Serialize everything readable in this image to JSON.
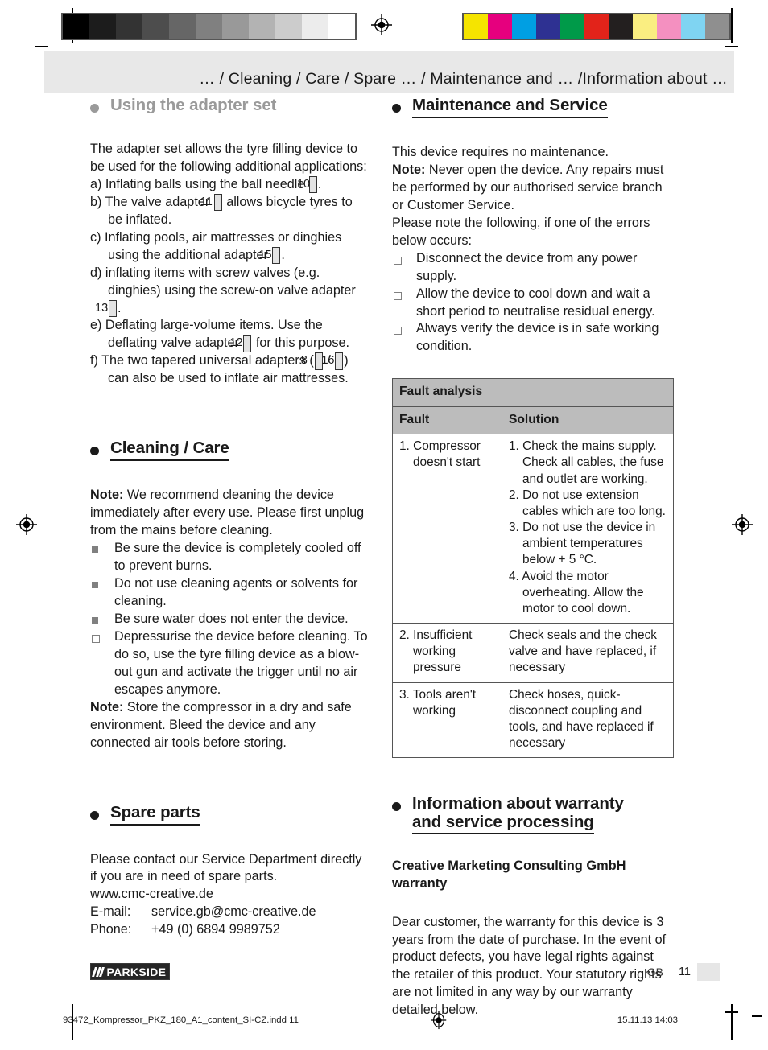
{
  "print_marks": {
    "grayscale_swatches": [
      "#000000",
      "#1c1c1c",
      "#333333",
      "#4d4d4d",
      "#666666",
      "#808080",
      "#999999",
      "#b3b3b3",
      "#cccccc",
      "#ececec",
      "#ffffff"
    ],
    "color_swatches": [
      "#f5e400",
      "#e6007e",
      "#009fe3",
      "#2e3192",
      "#009a49",
      "#e2231a",
      "#231f1f",
      "#faee81",
      "#f490c0",
      "#7fd4f2",
      "#8f8f8f"
    ],
    "registration_icon": "registration-target-icon"
  },
  "header": {
    "breadcrumb": "… / Cleaning / Care / Spare … / Maintenance and … /Information about …"
  },
  "left_column": {
    "adapter_section": {
      "heading": "Using the adapter set",
      "muted": true,
      "intro": "The adapter set allows the tyre filling device to be used for the following additional applications:",
      "items": [
        {
          "marker": "a)",
          "text_before": "Inflating balls using the ball needle ",
          "refs": [
            "10"
          ],
          "text_after": "."
        },
        {
          "marker": "b)",
          "text_before": "The valve adapter ",
          "refs": [
            "11"
          ],
          "text_after": " allows bicycle tyres to be inflated."
        },
        {
          "marker": "c)",
          "text_before": "Inflating pools, air mattresses or dinghies using the additional adapter ",
          "refs": [
            "15"
          ],
          "text_after": "."
        },
        {
          "marker": "d)",
          "text_before": "inflating items with screw valves (e.g. dinghies) using the screw-on valve adapter ",
          "refs": [
            "13"
          ],
          "text_after": "."
        },
        {
          "marker": "e)",
          "text_before": "Deflating large-volume items. Use the deflating valve adapter ",
          "refs": [
            "12"
          ],
          "text_after": " for this purpose."
        },
        {
          "marker": "f)",
          "text_before": "The two tapered universal adapters (",
          "refs": [
            "8",
            "16"
          ],
          "separator": " / ",
          "text_after": ") can also be used to inflate air mattresses."
        }
      ]
    },
    "cleaning_section": {
      "heading": "Cleaning / Care",
      "note_label": "Note:",
      "note_text": " We recommend cleaning the device immediately after every use. Please first unplug from the mains before cleaning.",
      "bullets": [
        {
          "marker": "filled",
          "text": "Be sure the device is completely cooled off to prevent burns."
        },
        {
          "marker": "filled",
          "text": "Do not use cleaning agents or solvents for cleaning."
        },
        {
          "marker": "filled",
          "text": "Be sure water does not enter the device."
        },
        {
          "marker": "hollow",
          "text": "Depressurise the device before cleaning. To do so, use the tyre filling device as a blow-out gun and activate the trigger until no air escapes anymore."
        }
      ],
      "note2_label": "Note:",
      "note2_text": " Store the compressor in a dry and safe environment. Bleed the device and any connected air tools before storing."
    },
    "spare_section": {
      "heading": "Spare parts",
      "intro": "Please contact our Service Department directly if you are in need of spare parts.",
      "website": "www.cmc-creative.de",
      "email_label": "E-mail:",
      "email_value": "service.gb@cmc-creative.de",
      "phone_label": "Phone:",
      "phone_value": "+49 (0) 6894 9989752"
    }
  },
  "right_column": {
    "maintenance_section": {
      "heading": "Maintenance and Service",
      "line1": "This device requires no maintenance.",
      "note_label": "Note:",
      "note_text": " Never open the device. Any repairs must be performed by our authorised service branch or Customer Service.",
      "line2": "Please note the following, if one of the errors below occurs:",
      "bullets": [
        {
          "marker": "hollow",
          "text": "Disconnect the device from any power supply."
        },
        {
          "marker": "hollow",
          "text": "Allow the device to cool down and wait a short period to neutralise residual energy."
        },
        {
          "marker": "hollow",
          "text": "Always verify the device is in safe working condition."
        }
      ]
    },
    "fault_table": {
      "title": "Fault analysis",
      "title_blank": "",
      "col_headers": [
        "Fault",
        "Solution"
      ],
      "rows": [
        {
          "fault": "1. Compressor doesn't start",
          "solution_items": [
            "1. Check the mains supply. Check all cables, the fuse and outlet are working.",
            "2. Do not use extension cables which are too long.",
            "3. Do not use the device in ambient temperatures below + 5 °C.",
            "4. Avoid the motor overheating. Allow the motor to cool down."
          ]
        },
        {
          "fault": "2. Insufficient working pressure",
          "solution_items": [
            "Check seals and the check valve and have replaced, if necessary"
          ]
        },
        {
          "fault": "3. Tools aren't working",
          "solution_items": [
            "Check hoses, quick-disconnect coupling and tools, and have replaced if necessary"
          ]
        }
      ]
    },
    "warranty_section": {
      "heading_line1": "Information about warranty",
      "heading_line2": "and service processing",
      "subheading_line1": "Creative Marketing Consulting GmbH",
      "subheading_line2": "warranty",
      "body": "Dear customer, the warranty for this device is 3 years from the date of purchase. In the event of product defects, you have legal rights against the retailer of this product. Your statutory rights are not limited in any way by our warranty detailed below."
    }
  },
  "footer": {
    "logo_text": "PARKSIDE",
    "country_code": "GB",
    "page_number": "11"
  },
  "imprint": {
    "file_name": "93472_Kompressor_PKZ_180_A1_content_SI-CZ.indd   11",
    "timestamp": "15.11.13   14:03"
  }
}
